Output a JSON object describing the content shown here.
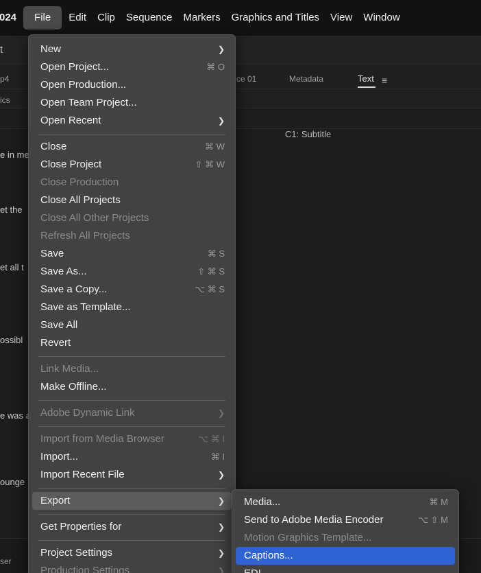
{
  "menubar": {
    "items": [
      {
        "label": "024"
      },
      {
        "label": "File"
      },
      {
        "label": "Edit"
      },
      {
        "label": "Clip"
      },
      {
        "label": "Sequence"
      },
      {
        "label": "Markers"
      },
      {
        "label": "Graphics and Titles"
      },
      {
        "label": "View"
      },
      {
        "label": "Window"
      }
    ]
  },
  "background": {
    "toolbar_fragment": "t",
    "tab_fragment": "p4",
    "sequence_tab": "ce 01",
    "metadata_tab": "Metadata",
    "text_tab": "Text",
    "hamburger": "≡",
    "panel_fragment": "ics",
    "subtitle_label": "C1: Subtitle",
    "transcript_lines": [
      "e in me",
      "et the",
      "et all t",
      "ossibl",
      "e was a",
      "ounge"
    ],
    "bottom_fragment": "ser"
  },
  "file_menu": {
    "items": [
      {
        "label": "New",
        "submenu": true
      },
      {
        "label": "Open Project...",
        "shortcut": "⌘ O"
      },
      {
        "label": "Open Production..."
      },
      {
        "label": "Open Team Project..."
      },
      {
        "label": "Open Recent",
        "submenu": true
      },
      {
        "separator": true
      },
      {
        "label": "Close",
        "shortcut": "⌘ W"
      },
      {
        "label": "Close Project",
        "shortcut": "⇧ ⌘ W"
      },
      {
        "label": "Close Production",
        "disabled": true
      },
      {
        "label": "Close All Projects"
      },
      {
        "label": "Close All Other Projects",
        "disabled": true
      },
      {
        "label": "Refresh All Projects",
        "disabled": true
      },
      {
        "label": "Save",
        "shortcut": "⌘ S"
      },
      {
        "label": "Save As...",
        "shortcut": "⇧ ⌘ S"
      },
      {
        "label": "Save a Copy...",
        "shortcut": "⌥ ⌘ S"
      },
      {
        "label": "Save as Template..."
      },
      {
        "label": "Save All"
      },
      {
        "label": "Revert"
      },
      {
        "separator": true
      },
      {
        "label": "Link Media...",
        "disabled": true
      },
      {
        "label": "Make Offline..."
      },
      {
        "separator": true
      },
      {
        "label": "Adobe Dynamic Link",
        "disabled": true,
        "submenu": true
      },
      {
        "separator": true
      },
      {
        "label": "Import from Media Browser",
        "disabled": true,
        "shortcut": "⌥ ⌘ I"
      },
      {
        "label": "Import...",
        "shortcut": "⌘ I"
      },
      {
        "label": "Import Recent File",
        "submenu": true
      },
      {
        "separator": true
      },
      {
        "label": "Export",
        "submenu": true,
        "highlight": "gray"
      },
      {
        "separator": true
      },
      {
        "label": "Get Properties for",
        "submenu": true
      },
      {
        "separator": true
      },
      {
        "label": "Project Settings",
        "submenu": true
      },
      {
        "label": "Production Settings",
        "submenu": true,
        "disabled": true
      }
    ]
  },
  "export_submenu": {
    "items": [
      {
        "label": "Media...",
        "shortcut": "⌘ M"
      },
      {
        "label": "Send to Adobe Media Encoder",
        "shortcut": "⌥ ⇧ M"
      },
      {
        "label": "Motion Graphics Template...",
        "disabled": true
      },
      {
        "label": "Captions...",
        "highlight": "blue"
      },
      {
        "label": "EDL..."
      }
    ]
  },
  "colors": {
    "menu_bg": "#444444",
    "highlight_blue": "#2f63d4",
    "highlight_gray": "#5c5c5c",
    "disabled_text": "#8a8a8a"
  },
  "icons": {
    "submenu_arrow": "chevron-right-icon",
    "text_tab_menu": "hamburger-icon"
  }
}
